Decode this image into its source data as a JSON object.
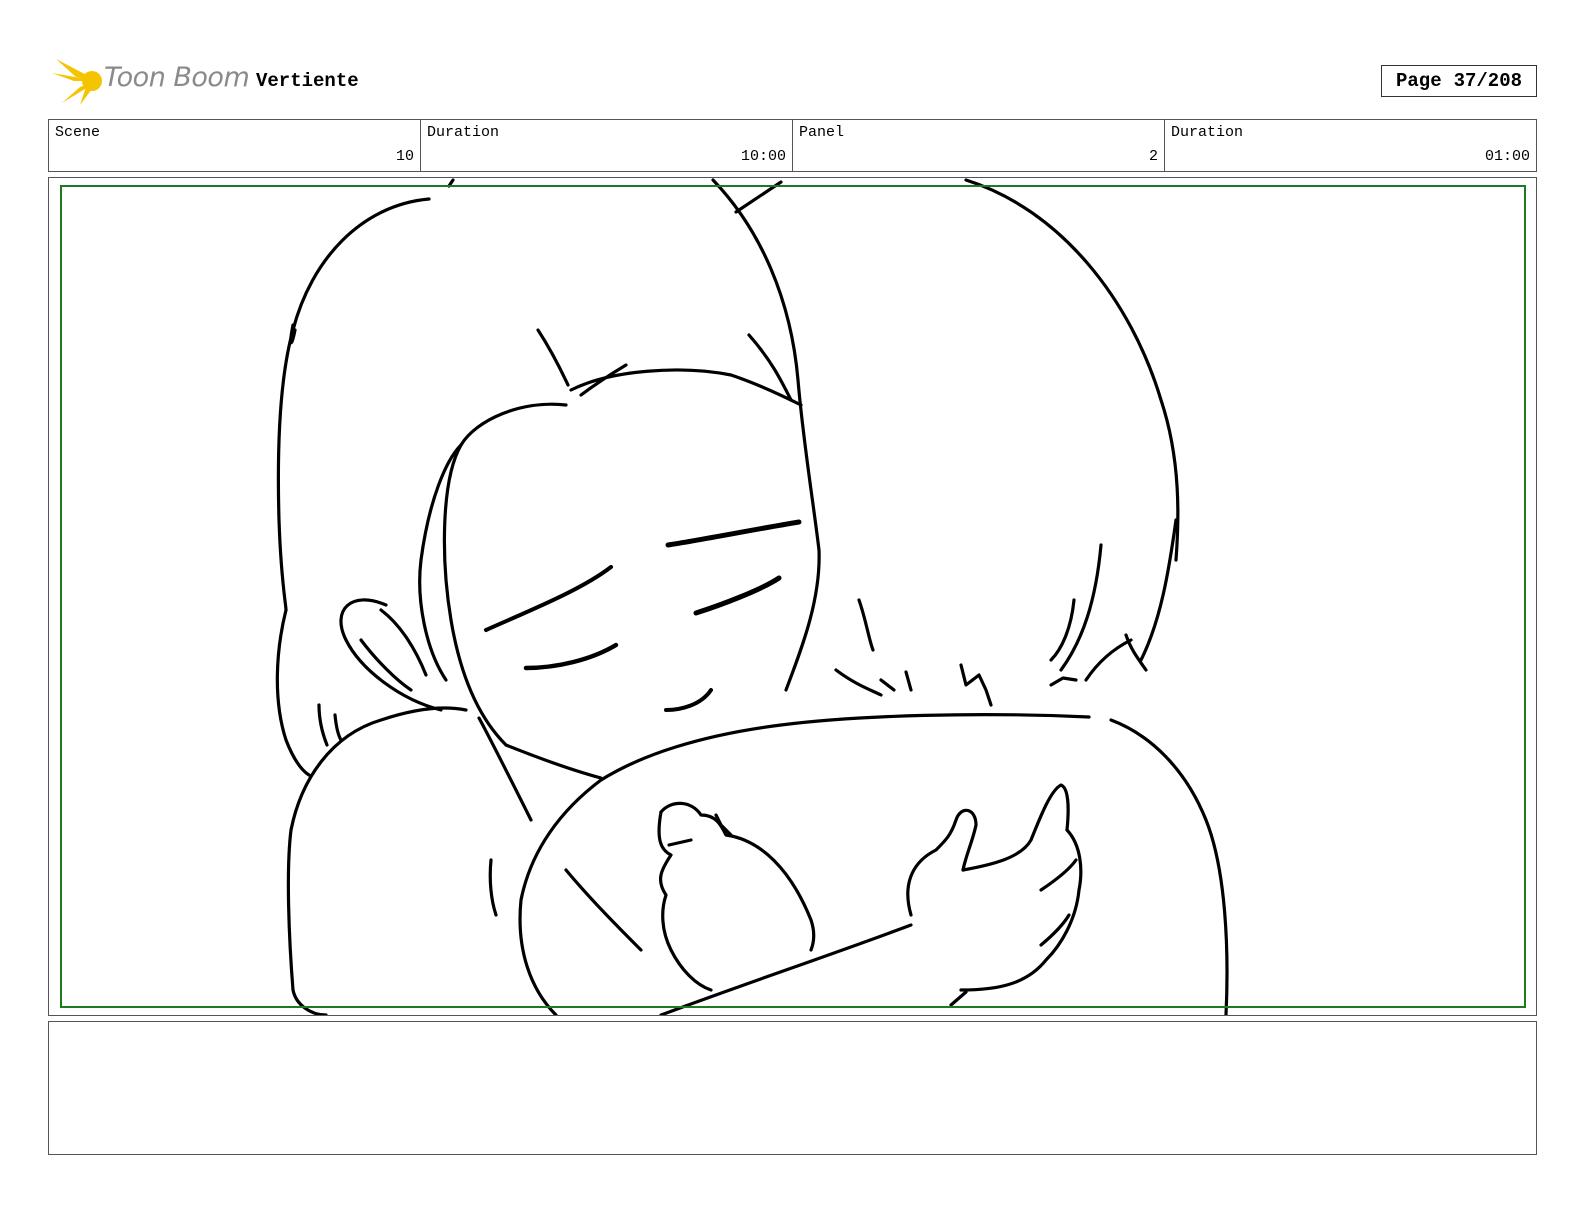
{
  "header": {
    "logo_text": "Toon Boom",
    "project": "Vertiente",
    "page_label": "Page",
    "page_value": "37/208"
  },
  "info": {
    "scene_label": "Scene",
    "scene_value": "10",
    "scene_duration_label": "Duration",
    "scene_duration_value": "10:00",
    "panel_label": "Panel",
    "panel_value": "2",
    "panel_duration_label": "Duration",
    "panel_duration_value": "01:00"
  },
  "notes": {
    "text": ""
  },
  "colors": {
    "safe_frame": "#1f7a1f",
    "logo_yellow": "#f5c400",
    "logo_text": "#8a8a8a"
  }
}
